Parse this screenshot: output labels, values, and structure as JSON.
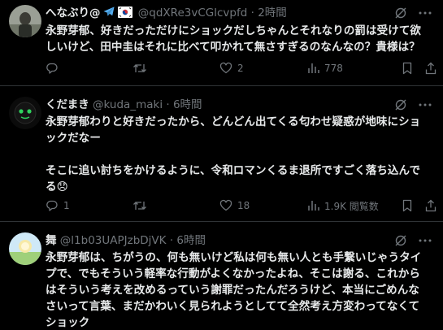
{
  "posts": [
    {
      "name": "へなぶり@",
      "flags": [
        "airplane",
        "kr-flag"
      ],
      "handle": "@qdXRe3vCGlcvpfd",
      "dot": "·",
      "time": "2時間",
      "lines": [
        [
          {
            "t": "永野芽郁",
            "b": true
          },
          {
            "t": "、好きだっただけに",
            "b": false
          },
          {
            "t": "ショック",
            "b": true
          },
          {
            "t": "だしちゃんとそれなりの罰は受けて欲",
            "b": false
          }
        ],
        [
          {
            "t": "しいけど、田中圭はそれに比べて叩かれて無さすぎるのなんなの？貴様は？",
            "b": false
          }
        ]
      ],
      "stats": {
        "reply": "",
        "retweet": "",
        "like": "2",
        "views": "778"
      }
    },
    {
      "name": "くだまき",
      "handle": "@kuda_maki",
      "dot": "·",
      "time": "6時間",
      "lines": [
        [
          {
            "t": "永野芽郁",
            "b": true
          },
          {
            "t": "わりと好きだったから、どんどん出てくる匂わせ疑惑が地味に",
            "b": false
          },
          {
            "t": "ショ",
            "b": true
          }
        ],
        [
          {
            "t": "ック",
            "b": true
          },
          {
            "t": "だなー",
            "b": false
          }
        ],
        [
          {
            "t": "",
            "b": false
          }
        ],
        [
          {
            "t": "そこに追い討ちをかけるように、令和ロマンくるま退所ですごく落ち込んで",
            "b": false
          }
        ],
        [
          {
            "t": "る",
            "b": false
          },
          {
            "t": "😞",
            "b": false
          }
        ]
      ],
      "stats": {
        "reply": "1",
        "retweet": "",
        "like": "18",
        "views": "1.9K 閲覧数"
      }
    },
    {
      "name": "舞",
      "handle": "@l1b03UAPJzbDjVK",
      "dot": "·",
      "time": "6時間",
      "lines": [
        [
          {
            "t": "永野芽郁",
            "b": true
          },
          {
            "t": "は、ちがうの、何も無いけど私は何も無い人とも手繋いじゃうタイ",
            "b": false
          }
        ],
        [
          {
            "t": "プで、でもそういう軽率な行動がよくなかったよね、そこは謝る、これから",
            "b": false
          }
        ],
        [
          {
            "t": "はそういう考えを改めるっていう謝罪だったんだろうけど、本当にごめんな",
            "b": false
          }
        ],
        [
          {
            "t": "さいって言葉、まだかわいく見られようとしてて全然考え方変わってなくて",
            "b": false
          }
        ],
        [
          {
            "t": "ショック",
            "b": true
          }
        ]
      ]
    }
  ],
  "colors": {
    "background": "#000000",
    "text": "#e7e9ea",
    "muted": "#71767b",
    "divider": "#2f3336"
  }
}
